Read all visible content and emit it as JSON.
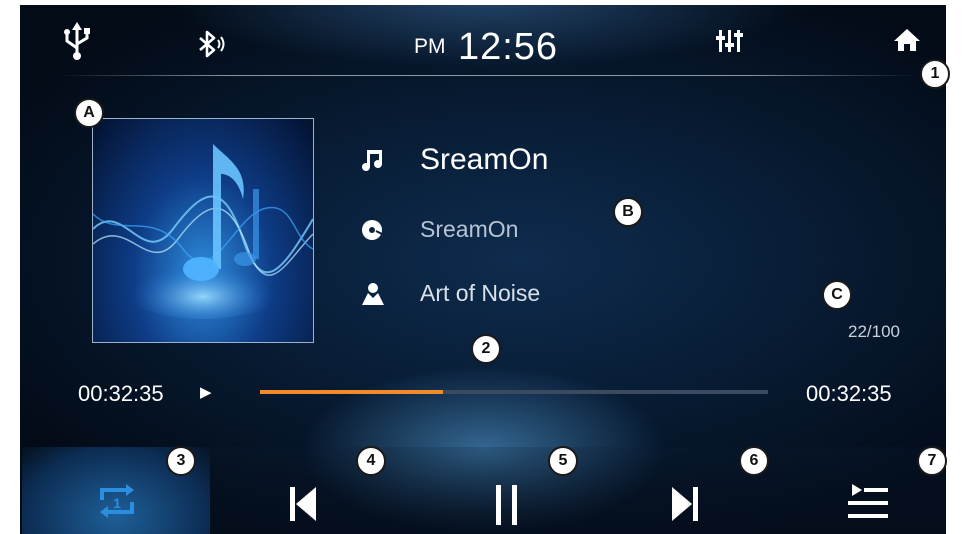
{
  "status_bar": {
    "ampm": "PM",
    "time": "12:56",
    "icons": [
      "usb-icon",
      "bluetooth-audio-icon",
      "equalizer-icon",
      "home-icon"
    ]
  },
  "track": {
    "title": "SreamOn",
    "album": "SreamOn",
    "artist": "Art of Noise",
    "count": "22/100"
  },
  "progress": {
    "elapsed": "00:32:35",
    "total": "00:32:35",
    "play_state_glyph": "▶",
    "fraction": 0.36,
    "fill_color": "#f08a2a"
  },
  "controls": {
    "buttons": [
      "repeat-one",
      "previous",
      "pause",
      "next",
      "playlist"
    ]
  },
  "callouts": {
    "c1": "1",
    "c2": "2",
    "c3": "3",
    "c4": "4",
    "c5": "5",
    "c6": "6",
    "c7": "7",
    "cA": "A",
    "cB": "B",
    "cC": "C"
  },
  "colors": {
    "accent_repeat": "#2a8fe0",
    "background": "#071a31"
  }
}
